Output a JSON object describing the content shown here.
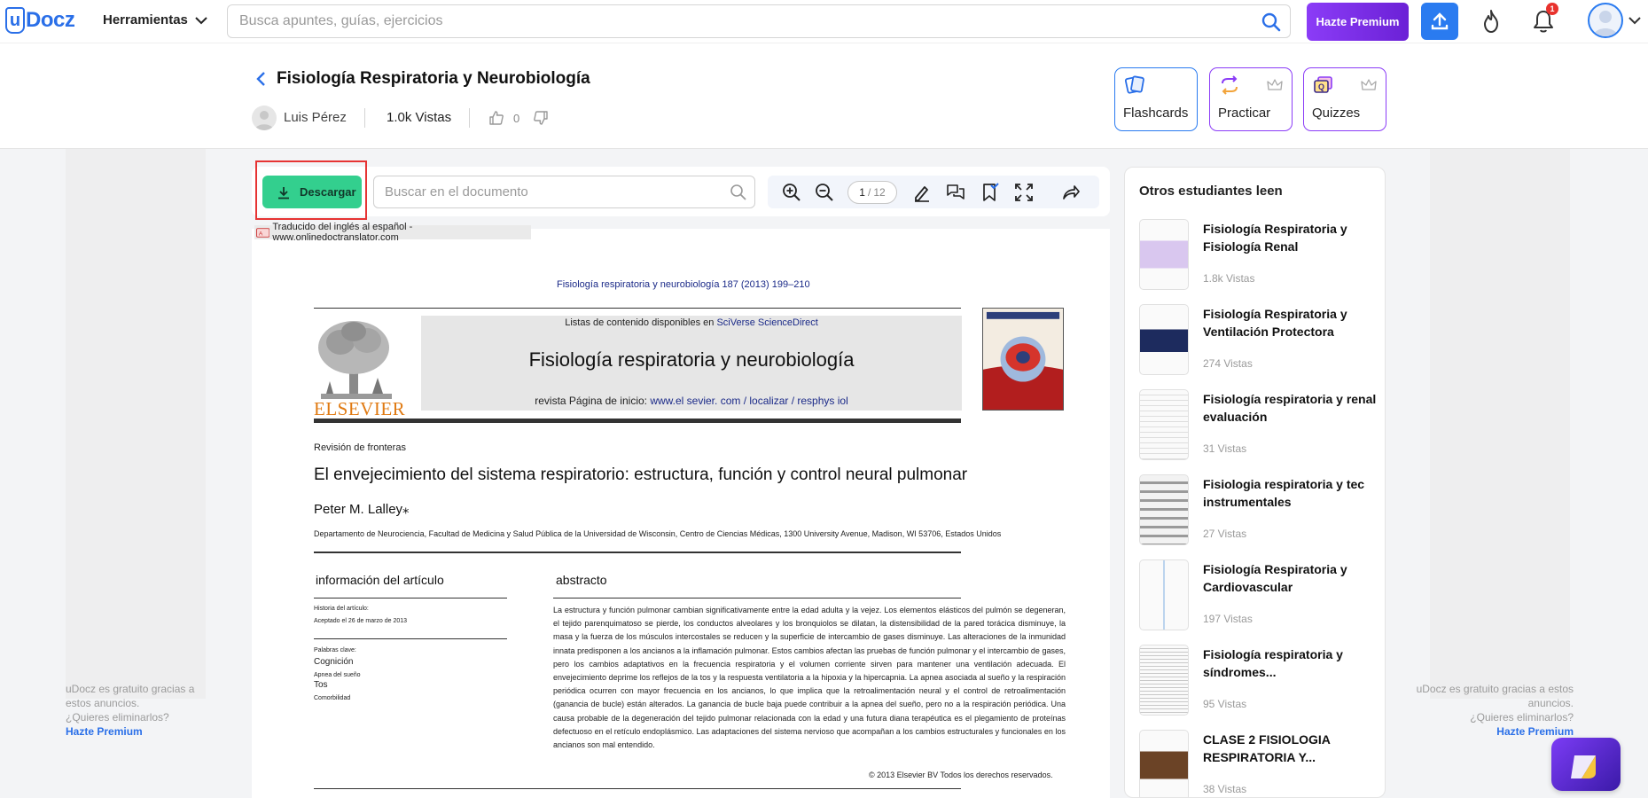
{
  "brand": {
    "logo_letter": "u",
    "logo_text": "Docz"
  },
  "nav": {
    "tools_label": "Herramientas",
    "search_placeholder": "Busca apuntes, guías, ejercicios",
    "premium_label": "Hazte Premium",
    "notification_count": "1"
  },
  "doc": {
    "title": "Fisiología Respiratoria y Neurobiología",
    "author": "Luis Pérez",
    "views": "1.0k Vistas",
    "likes": "0"
  },
  "study_tools": [
    {
      "label": "Flashcards"
    },
    {
      "label": "Practicar"
    },
    {
      "label": "Quizzes"
    }
  ],
  "toolbar": {
    "download_label": "Descargar",
    "search_placeholder": "Buscar en el documento",
    "page_current": "1",
    "page_total": "12"
  },
  "ads": {
    "line1": "uDocz es gratuito gracias a estos anuncios.",
    "line2": "¿Quieres eliminarlos?",
    "link": "Hazte Premium"
  },
  "document": {
    "translated_note": "Traducido del inglés al español - www.onlinedoctranslator.com",
    "journal_ref": "Fisiología respiratoria y neurobiología 187 (2013) 199–210",
    "contents_prefix": "Listas de contenido disponibles en ",
    "contents_link": "SciVerse ScienceDirect",
    "journal_title": "Fisiología respiratoria y neurobiología",
    "homepage_prefix": "revista Página de inicio: ",
    "homepage_link": "www.el sevier. com / localizar / resphys iol",
    "publisher": "ELSEVIER",
    "section": "Revisión de fronteras",
    "article_title": "El envejecimiento del sistema respiratorio: estructura, función y control neural pulmonar",
    "author": "Peter M. Lalley",
    "author_mark": "⁎",
    "affiliation": "Departamento de Neurociencia, Facultad de Medicina y Salud Pública de la Universidad de Wisconsin, Centro de Ciencias Médicas, 1300 University Avenue, Madison, WI 53706, Estados Unidos",
    "info_heading": "información del artículo",
    "history_label": "Historia del artículo:",
    "accepted": "Aceptado el 26 de marzo de 2013",
    "keywords_label": "Palabras clave:",
    "keywords": [
      "Cognición",
      "Apnea del sueño",
      "Tos",
      "Comorbilidad"
    ],
    "abstract_heading": "abstracto",
    "abstract_text": "La estructura y función pulmonar cambian significativamente entre la edad adulta y la vejez. Los elementos elásticos del pulmón se degeneran, el tejido parenquimatoso se pierde, los conductos alveolares y los bronquiolos se dilatan, la distensibilidad de la pared torácica disminuye, la masa y la fuerza de los músculos intercostales se reducen y la superficie de intercambio de gases disminuye. Las alteraciones de la inmunidad innata predisponen a los ancianos a la inflamación pulmonar. Estos cambios afectan las pruebas de función pulmonar y el intercambio de gases, pero los cambios adaptativos en la frecuencia respiratoria y el volumen corriente sirven para mantener una ventilación adecuada. El envejecimiento deprime los reflejos de la tos y la respuesta ventilatoria a la hipoxia y la hipercapnia. La apnea asociada al sueño y la respiración periódica ocurren con mayor frecuencia en los ancianos, lo que implica que la retroalimentación neural y el control de retroalimentación (ganancia de bucle) están alterados. La ganancia de bucle baja puede contribuir a la apnea del sueño, pero no a la respiración periódica. Una causa probable de la degeneración del tejido pulmonar relacionada con la edad y una futura diana terapéutica es el plegamiento de proteínas defectuoso en el retículo endoplásmico. Las adaptaciones del sistema nervioso que acompañan a los cambios estructurales y funcionales en los ancianos son mal entendido.",
    "copyright": "© 2013 Elsevier BV Todos los derechos reservados."
  },
  "sidebar": {
    "title": "Otros estudiantes leen",
    "items": [
      {
        "title": "Fisiología Respiratoria y Fisiología Renal",
        "views": "1.8k Vistas"
      },
      {
        "title": "Fisiología Respiratoria y Ventilación Protectora",
        "views": "274 Vistas"
      },
      {
        "title": "Fisiología respiratoria y renal evaluación",
        "views": "31 Vistas"
      },
      {
        "title": "Fisiologia respiratoria y tec instrumentales",
        "views": "27 Vistas"
      },
      {
        "title": "Fisiología Respiratoria y Cardiovascular",
        "views": "197 Vistas"
      },
      {
        "title": "Fisiología respiratoria y síndromes...",
        "views": "95 Vistas"
      },
      {
        "title": "CLASE 2 FISIOLOGIA RESPIRATORIA Y...",
        "views": "38 Vistas"
      }
    ]
  },
  "colors": {
    "brand_blue": "#2a6fe8",
    "premium_purple": "#8b3cf7",
    "download_green": "#33cf8e",
    "highlight_red": "#e63333"
  }
}
